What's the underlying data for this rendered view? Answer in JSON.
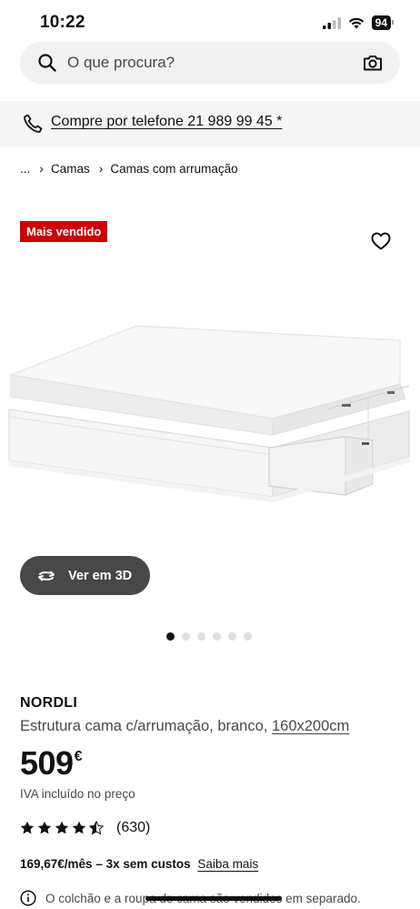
{
  "status_bar": {
    "time": "10:22",
    "battery": "94"
  },
  "search": {
    "placeholder": "O que procura?"
  },
  "phone_banner": {
    "text": "Compre por telefone 21 989 99 45 *"
  },
  "breadcrumb": {
    "ellipsis": "...",
    "items": [
      "Camas",
      "Camas com arrumação"
    ]
  },
  "product": {
    "badge": "Mais vendido",
    "view_3d_label": "Ver em 3D",
    "carousel": {
      "total": 6,
      "active": 1
    },
    "name": "NORDLI",
    "description": "Estrutura cama c/arrumação, branco,",
    "size": "160x200cm",
    "price": "509",
    "currency": "€",
    "vat_note": "IVA incluído no preço",
    "rating": {
      "value": 4.5,
      "max": 5,
      "count": "(630)"
    },
    "financing": "169,67€/mês – 3x sem custos",
    "financing_link": "Saiba mais",
    "notice": "O colchão e a roupa de cama são vendidos em separado."
  },
  "colors": {
    "badge": "#cc0008",
    "button_3d": "#484848",
    "text": "#111111"
  },
  "icons": [
    "search-icon",
    "camera-icon",
    "phone-icon",
    "heart-icon",
    "rotate-3d-icon",
    "star-icon",
    "info-icon"
  ]
}
